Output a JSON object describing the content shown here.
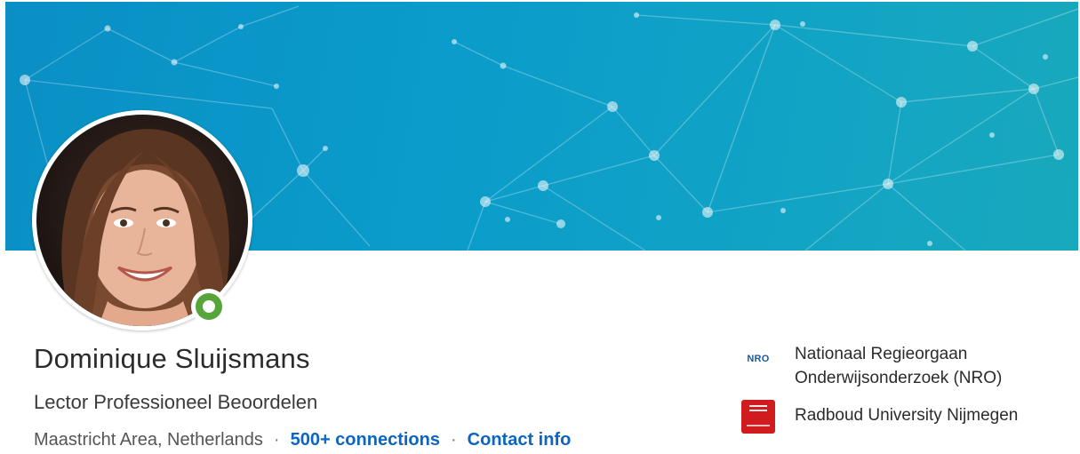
{
  "profile": {
    "name": "Dominique Sluijsmans",
    "headline": "Lector Professioneel Beoordelen",
    "location": "Maastricht Area, Netherlands",
    "separator": "·",
    "connections": "500+ connections",
    "contact_info": "Contact info",
    "status": "online"
  },
  "organizations": [
    {
      "name_line1": "Nationaal Regieorgaan",
      "name_line2": "Onderwijsonderzoek (NRO)",
      "logo_text": "NRO",
      "logo_icon": "nro-logo-icon"
    },
    {
      "name_line1": "Radboud University Nijmegen",
      "logo_icon": "radboud-logo-icon"
    }
  ],
  "colors": {
    "banner": "#0a9ccb",
    "link": "#0a66c2",
    "status_green": "#56a53a",
    "radboud_red": "#d01c1f"
  }
}
